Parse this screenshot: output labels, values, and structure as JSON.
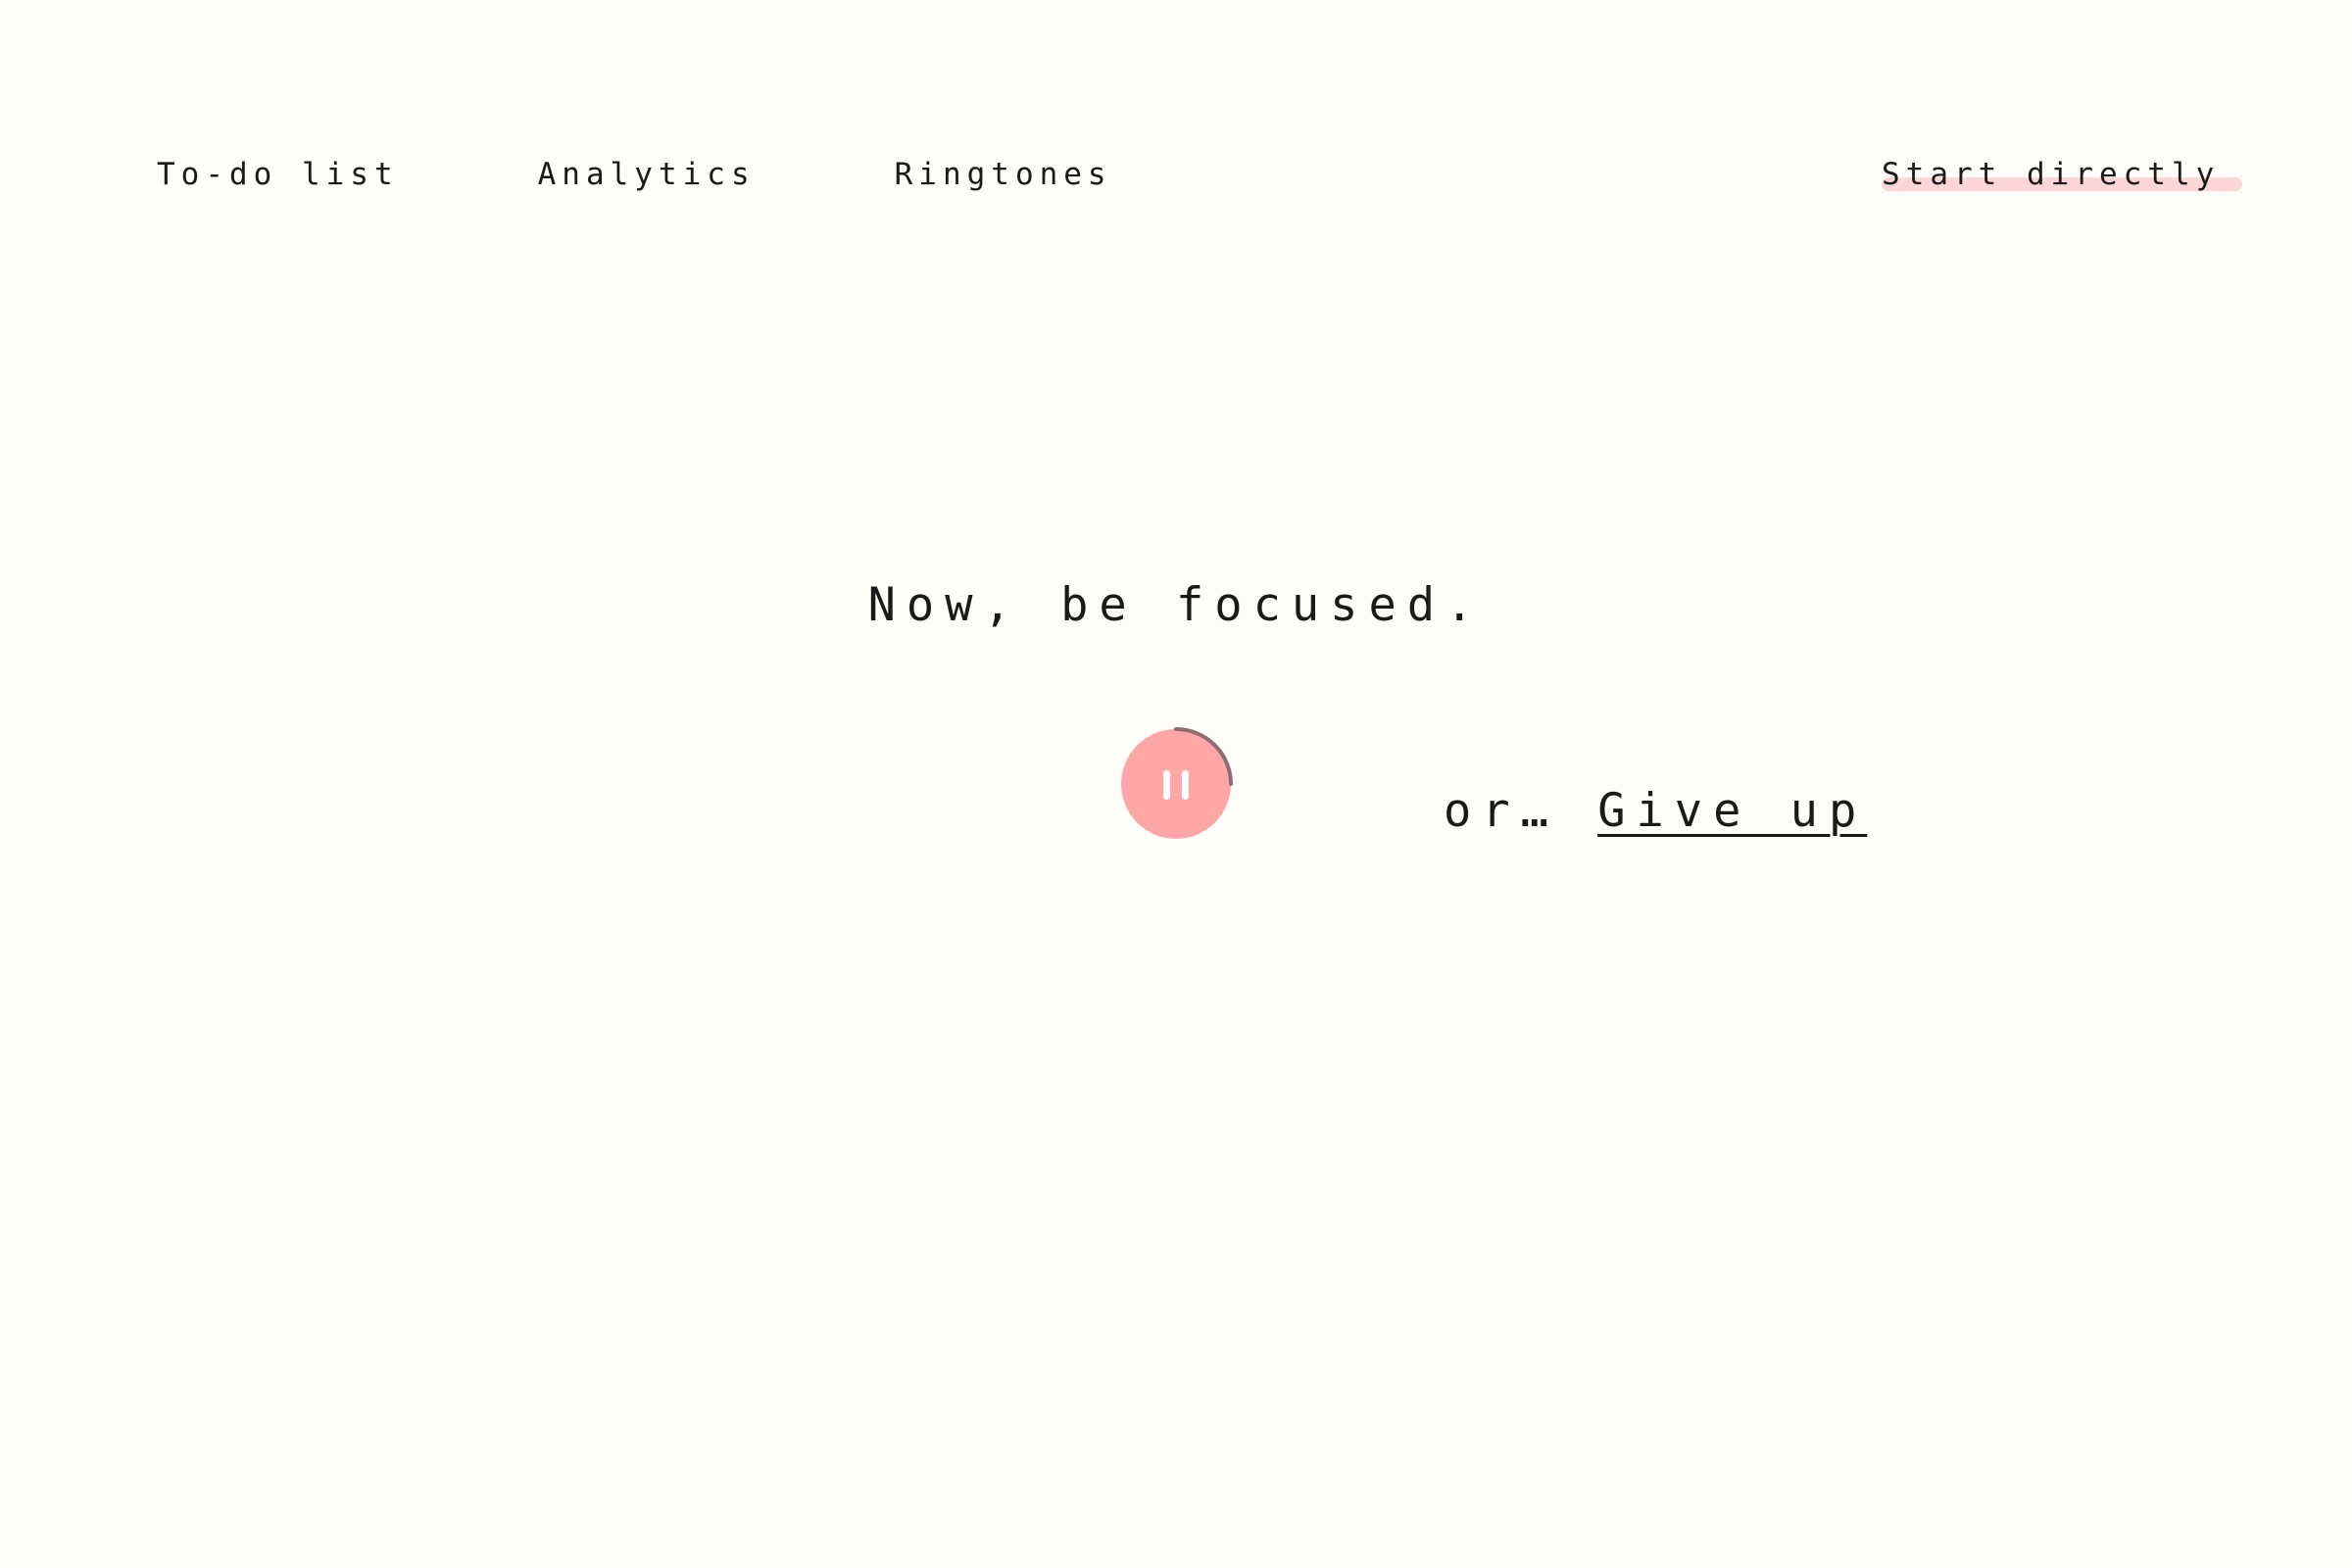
{
  "nav": {
    "items": [
      {
        "label": "To-do list"
      },
      {
        "label": "Analytics"
      },
      {
        "label": "Ringtones"
      }
    ],
    "start_label": "Start directly"
  },
  "main": {
    "headline": "Now, be focused.",
    "timer": {
      "state": "running",
      "control_icon": "pause-icon",
      "progress_fraction": 0.25
    },
    "or_text": "or…",
    "give_up_label": "Give up"
  },
  "colors": {
    "background": "#fffdf8",
    "accent": "#ffa7a7",
    "highlight": "#ffd6d6",
    "progress_ring": "#8a6f72",
    "text": "#1a1a1a"
  }
}
